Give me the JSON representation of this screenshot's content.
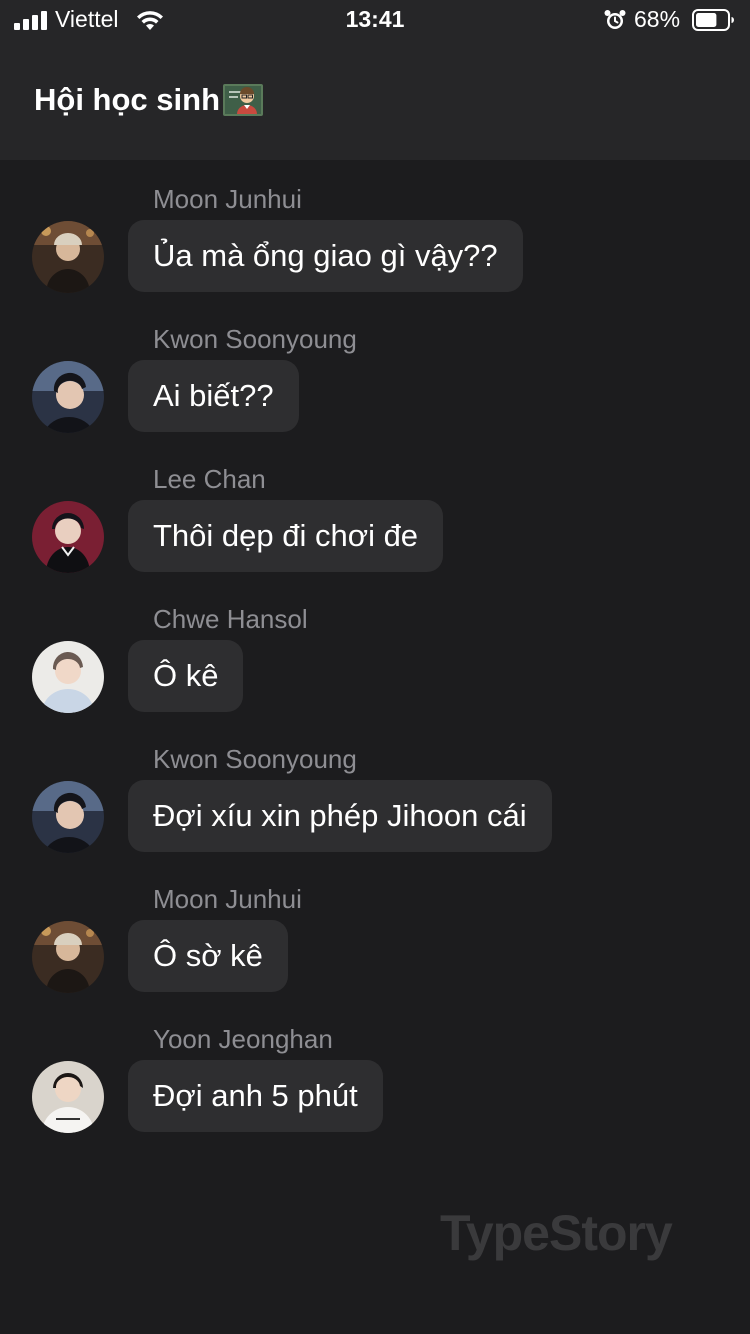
{
  "status_bar": {
    "carrier": "Viettel",
    "time": "13:41",
    "battery_percent": "68%",
    "battery_level": 0.68,
    "icons": [
      "signal-icon",
      "wifi-icon",
      "alarm-icon",
      "battery-icon"
    ]
  },
  "header": {
    "title": "Hội học sinh",
    "title_emoji": "teacher-emoji"
  },
  "messages": [
    {
      "sender": "Moon Junhui",
      "text": "Ủa mà ổng giao gì vậy??",
      "avatar": "avatar-moon-junhui"
    },
    {
      "sender": "Kwon Soonyoung",
      "text": "Ai biết??",
      "avatar": "avatar-kwon-soonyoung"
    },
    {
      "sender": "Lee Chan",
      "text": "Thôi dẹp đi chơi đe",
      "avatar": "avatar-lee-chan"
    },
    {
      "sender": "Chwe Hansol",
      "text": "Ô kê",
      "avatar": "avatar-chwe-hansol"
    },
    {
      "sender": "Kwon Soonyoung",
      "text": "Đợi xíu xin phép Jihoon cái",
      "avatar": "avatar-kwon-soonyoung"
    },
    {
      "sender": "Moon Junhui",
      "text": "Ô sờ kê",
      "avatar": "avatar-moon-junhui"
    },
    {
      "sender": "Yoon Jeonghan",
      "text": "Đợi anh 5 phút",
      "avatar": "avatar-yoon-jeonghan"
    }
  ],
  "watermark": "TypeStory",
  "colors": {
    "background": "#1c1c1e",
    "header": "#262628",
    "bubble": "#2e2e30",
    "sender_name": "#8e8e93",
    "watermark": "#3a3a3c"
  }
}
